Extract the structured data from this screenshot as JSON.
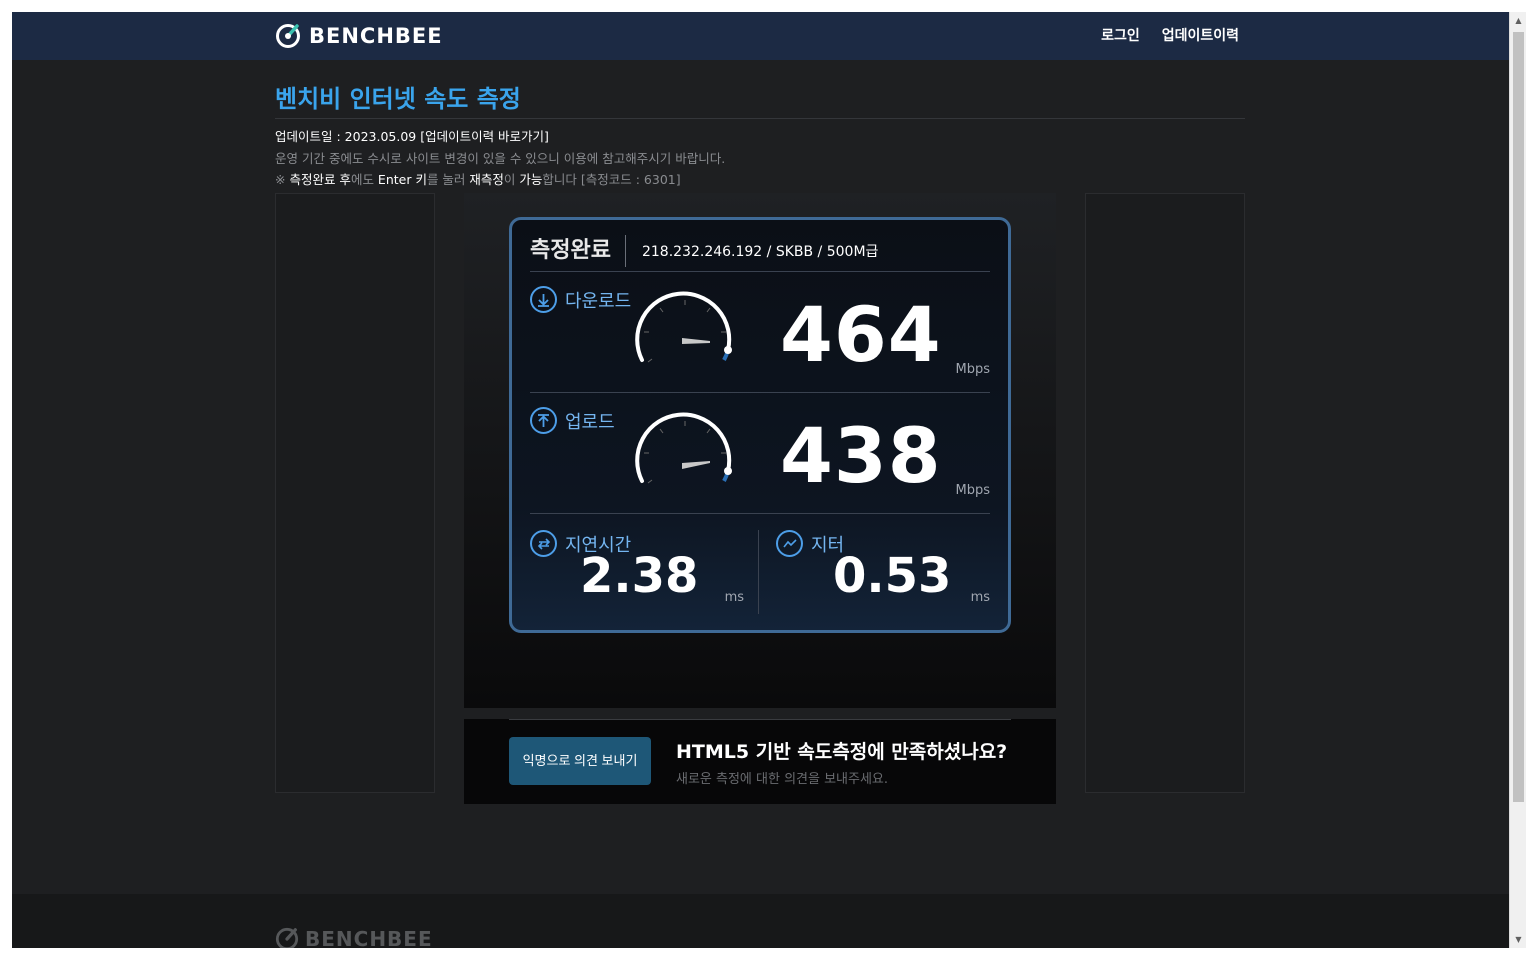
{
  "header": {
    "logo_text": "BENCHBEE",
    "nav": [
      {
        "label": "로그인"
      },
      {
        "label": "업데이트이력"
      }
    ]
  },
  "page": {
    "title": "벤치비 인터넷 속도 측정",
    "update_line": "업데이트일 : 2023.05.09 [업데이트이력 바로가기]",
    "notice_line": "운영 기간 중에도 수시로 사이트 변경이 있을 수 있으니 이용에 참고해주시기 바랍니다.",
    "tip": {
      "prefix": "※ ",
      "a": "측정완료 후",
      "b": "에도 ",
      "c": "Enter 키",
      "d": "를 눌러 ",
      "e": "재측정",
      "f": "이 ",
      "g": "가능",
      "h": "합니다 [측정코드 : 6301]"
    }
  },
  "result": {
    "status": "측정완료",
    "connection": "218.232.246.192 / SKBB / 500M급",
    "download": {
      "label": "다운로드",
      "value": "464",
      "unit": "Mbps"
    },
    "upload": {
      "label": "업로드",
      "value": "438",
      "unit": "Mbps"
    },
    "latency": {
      "label": "지연시간",
      "value": "2.38",
      "unit": "ms"
    },
    "jitter": {
      "label": "지터",
      "value": "0.53",
      "unit": "ms"
    }
  },
  "feedback": {
    "button": "익명으로 의견 보내기",
    "title": "HTML5 기반 속도측정에 만족하셨나요?",
    "subtitle": "새로운 측정에 대한 의견을 보내주세요."
  },
  "footer": {
    "logo_text": "BENCHBEE"
  },
  "colors": {
    "header_bg": "#1c2a44",
    "accent": "#3aa4ec",
    "card_border": "#3f6a96",
    "button_bg": "#1e5777"
  }
}
